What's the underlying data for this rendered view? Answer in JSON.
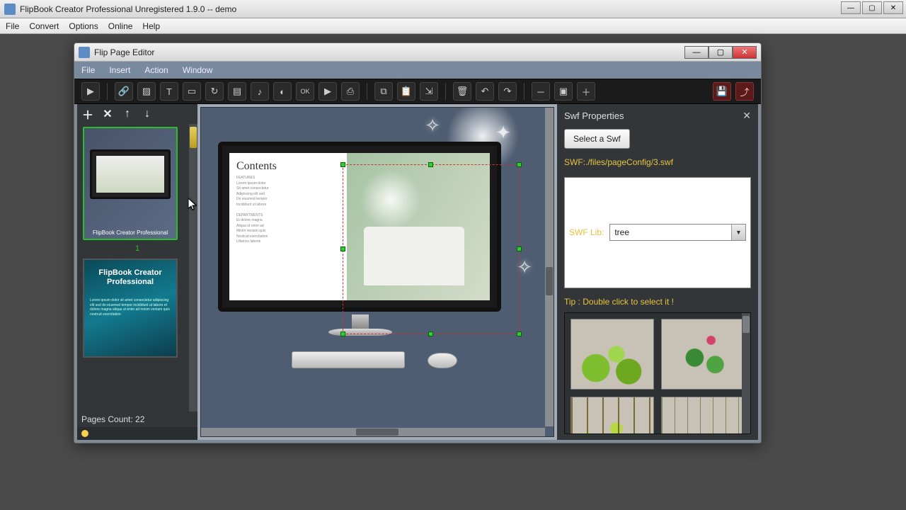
{
  "outer": {
    "title": "FlipBook Creator Professional Unregistered 1.9.0  -- demo",
    "menus": [
      "File",
      "Convert",
      "Options",
      "Online",
      "Help"
    ]
  },
  "inner": {
    "title": "Flip Page Editor",
    "menus": [
      "File",
      "Insert",
      "Action",
      "Window"
    ]
  },
  "toolbar": {
    "icons": [
      "pointer",
      "link",
      "image",
      "text",
      "shape",
      "swf",
      "video",
      "sound",
      "flash",
      "ok",
      "youtube",
      "print"
    ],
    "icons2": [
      "copy",
      "paste",
      "paste-style"
    ],
    "icons3": [
      "delete",
      "undo",
      "redo"
    ],
    "icons4": [
      "zoom-out",
      "fit",
      "zoom-in"
    ],
    "icons5": [
      "save",
      "save-exit"
    ]
  },
  "sidebar": {
    "btns": [
      "add",
      "remove",
      "move-up",
      "move-down"
    ],
    "page1_caption": "FlipBook Creator Professional",
    "page1_num": "1",
    "page2_title": "FlipBook Creator Professional",
    "pages_count_label": "Pages Count: 22"
  },
  "canvas": {
    "contents_title": "Contents"
  },
  "props": {
    "title": "Swf Properties",
    "select_btn": "Select a Swf",
    "swf_path": "SWF:./files/pageConfig/3.swf",
    "lib_label": "SWF Lib:",
    "lib_value": "tree",
    "tip": "Tip : Double click to select it !"
  }
}
